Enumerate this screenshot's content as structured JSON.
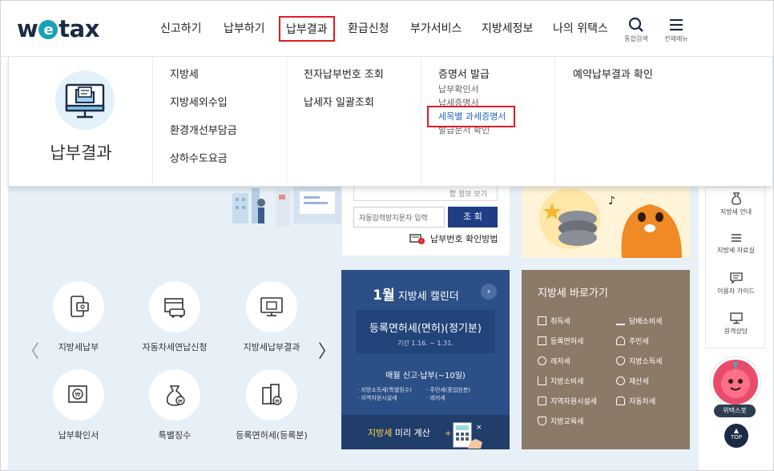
{
  "brand": {
    "logo_w": "w",
    "logo_e": "e",
    "logo_rest": "tax",
    "accent": "#17a2b8",
    "navy": "#1b2b44"
  },
  "gnb": {
    "items": [
      "신고하기",
      "납부하기",
      "납부결과",
      "환급신청",
      "부가서비스",
      "지방세정보",
      "나의 위택스"
    ],
    "active": "납부결과",
    "search_label": "통합검색",
    "allmenu_label": "전체메뉴"
  },
  "mega": {
    "title": "납부결과",
    "col1": [
      "지방세",
      "지방세외수입",
      "환경개선부담금",
      "상하수도요금"
    ],
    "col2": [
      "전자납부번호 조회",
      "납세자 일괄조회"
    ],
    "col3_head": "증명서 발급",
    "col3": [
      "납부확인서",
      "납세증명서",
      "세목별 과세증명서",
      "발급문서 확인"
    ],
    "col3_highlight": "세목별 과세증명서",
    "col4": [
      "예약납부결과 확인"
    ]
  },
  "search": {
    "topline": "합 정보 보기",
    "captcha_placeholder": "자동입력방지문자 입력",
    "button": "조 회",
    "receipt_link": "납부번호 확인방법"
  },
  "quick": {
    "row1": [
      "지방세납부",
      "자동차세연납신청",
      "지방세납부결과"
    ],
    "row2": [
      "납부확인서",
      "특별징수",
      "등록면허세(등록분)"
    ],
    "prev": "〈",
    "next": "〉"
  },
  "calendar": {
    "month": "1월",
    "title": "지방세 캘린더",
    "next_arrow": "›",
    "event": "등록면허세(면허)(정기분)",
    "period": "기간 1.16. ~ 1.31.",
    "monthly": "매월 신고·납부(~10일)",
    "list_left": [
      "· 지방소득세(특별징수)",
      "· 지역자원시설세"
    ],
    "list_right": [
      "· 주민세(종업원분)",
      "· 레저세"
    ],
    "calc_hl": "지방세",
    "calc_rest": " 미리 계산"
  },
  "shortcuts": {
    "title": "지방세 바로가기",
    "left": [
      "취득세",
      "등록면허세",
      "레저세",
      "지방소비세",
      "지역자원시설세",
      "지방교육세"
    ],
    "right": [
      "담배소비세",
      "주민세",
      "지방소득세",
      "재산세",
      "자동차세"
    ]
  },
  "side": {
    "items": [
      "지방세 안내",
      "지방세 자료실",
      "이용자 가이드",
      "원격상담"
    ],
    "bot": "위택스봇",
    "top": "TOP",
    "top_arrow": "▲"
  }
}
